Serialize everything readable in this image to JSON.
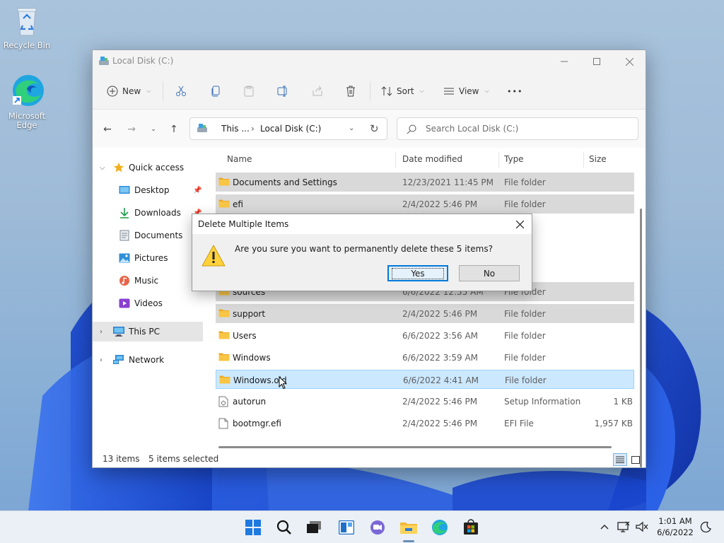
{
  "desktop": {
    "icons": [
      {
        "label": "Recycle Bin"
      },
      {
        "label": "Microsoft Edge"
      }
    ]
  },
  "window": {
    "title": "Local Disk (C:)",
    "minimize_icon": "minimize-icon",
    "maximize_icon": "maximize-icon",
    "close_icon": "close-icon"
  },
  "toolbar": {
    "new_label": "New",
    "sort_label": "Sort",
    "view_label": "View",
    "more_label": "•••"
  },
  "address": {
    "crumbs": [
      "This ...",
      "Local Disk (C:)"
    ],
    "search_placeholder": "Search Local Disk (C:)"
  },
  "sidebar": {
    "quick_access": "Quick access",
    "items": [
      {
        "label": "Desktop",
        "pinned": true
      },
      {
        "label": "Downloads",
        "pinned": true
      },
      {
        "label": "Documents"
      },
      {
        "label": "Pictures"
      },
      {
        "label": "Music"
      },
      {
        "label": "Videos"
      }
    ],
    "this_pc": "This PC",
    "network": "Network"
  },
  "columns": {
    "name": "Name",
    "date": "Date modified",
    "type": "Type",
    "size": "Size"
  },
  "files": [
    {
      "name": "Documents and Settings",
      "date": "12/23/2021 11:45 PM",
      "type": "File folder",
      "size": "",
      "kind": "folder",
      "selected": true
    },
    {
      "name": "efi",
      "date": "2/4/2022 5:46 PM",
      "type": "File folder",
      "size": "",
      "kind": "folder",
      "selected": true
    },
    {
      "name": "",
      "date": "",
      "type": "der",
      "size": "",
      "kind": "folder",
      "selected": false
    },
    {
      "name": "",
      "date": "",
      "type": "der",
      "size": "",
      "kind": "folder",
      "selected": false
    },
    {
      "name": "",
      "date": "",
      "type": "der",
      "size": "",
      "kind": "folder",
      "selected": false
    },
    {
      "name": "sources",
      "date": "6/6/2022 12:55 AM",
      "type": "File folder",
      "size": "",
      "kind": "folder",
      "selected": true
    },
    {
      "name": "support",
      "date": "2/4/2022 5:46 PM",
      "type": "File folder",
      "size": "",
      "kind": "folder",
      "selected": true
    },
    {
      "name": "Users",
      "date": "6/6/2022 3:56 AM",
      "type": "File folder",
      "size": "",
      "kind": "folder",
      "selected": false
    },
    {
      "name": "Windows",
      "date": "6/6/2022 3:59 AM",
      "type": "File folder",
      "size": "",
      "kind": "folder",
      "selected": false
    },
    {
      "name": "Windows.old",
      "date": "6/6/2022 4:41 AM",
      "type": "File folder",
      "size": "",
      "kind": "folder",
      "selected": true,
      "focused": true
    },
    {
      "name": "autorun",
      "date": "2/4/2022 5:46 PM",
      "type": "Setup Information",
      "size": "1 KB",
      "kind": "setup",
      "selected": false
    },
    {
      "name": "bootmgr.efi",
      "date": "2/4/2022 5:46 PM",
      "type": "EFI File",
      "size": "1,957 KB",
      "kind": "file",
      "selected": false
    }
  ],
  "status": {
    "count": "13 items",
    "selected": "5 items selected"
  },
  "dialog": {
    "title": "Delete Multiple Items",
    "message": "Are you sure you want to permanently delete these 5 items?",
    "yes_label": "Yes",
    "no_label": "No"
  },
  "taskbar": {
    "time": "1:01 AM",
    "date": "6/6/2022"
  },
  "colors": {
    "accent": "#0078d7",
    "selection": "#cce8ff",
    "folder": "#f8c545"
  }
}
